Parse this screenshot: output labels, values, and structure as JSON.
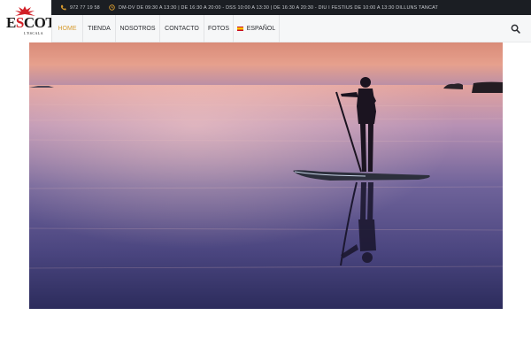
{
  "brand": {
    "logo_text_prefix": "E",
    "logo_text_red": "S",
    "logo_text_suffix": "COT",
    "logo_subtitle": "L'ESCALA",
    "accent_color": "#d79b2f",
    "brand_red": "#d21f26"
  },
  "topbar": {
    "phone_icon": "phone-icon",
    "phone": "972 77 19 58",
    "hours_icon": "clock-icon",
    "hours": "DM-DV DE 09:30 A 13:30 | DE 16:30 A 20:00 - DSS 10:00 A 13:30 | DE 16:30 A 20:30 - DIU I FESTIUS DE 10:00 A 13:30 DILLUNS TANCAT"
  },
  "nav": {
    "items": [
      {
        "label": "HOME",
        "active": true
      },
      {
        "label": "TIENDA",
        "active": false
      },
      {
        "label": "NOSOTROS",
        "active": false
      },
      {
        "label": "CONTACTO",
        "active": false
      },
      {
        "label": "FOTOS",
        "active": false
      },
      {
        "label": "ESPAÑOL",
        "active": false,
        "flag": "spain-flag-icon"
      }
    ],
    "search_icon": "search-icon"
  },
  "hero": {
    "subject": "paddle-boarder-silhouette-at-sunset"
  }
}
